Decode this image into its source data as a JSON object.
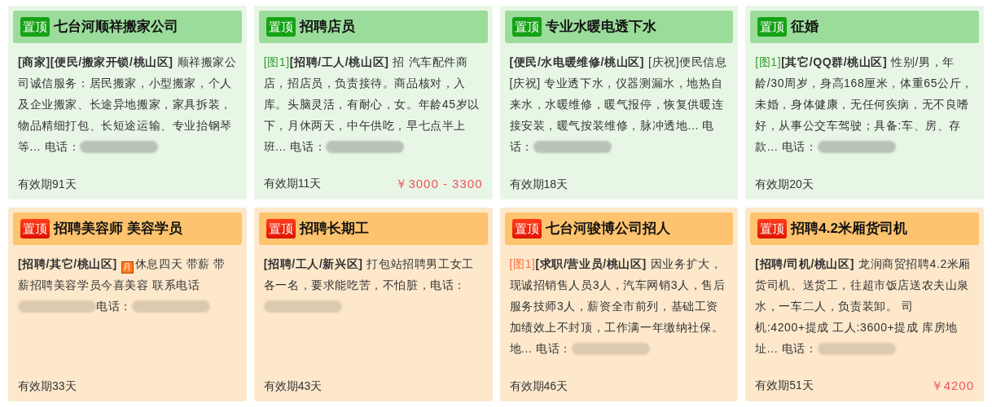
{
  "posts": [
    {
      "kind": "green",
      "badge": "置顶",
      "title": "七台河顺祥搬家公司",
      "body": [
        {
          "kind": "category",
          "text": "[商家][便民/搬家开锁/桃山区]"
        },
        {
          "kind": "text",
          "text": "顺祥搬家公司诚信服务：居民搬家，小型搬家，个人及企业搬家、长途异地搬家，家具拆装，物品精细打包、长短途运输、专业抬钢琴等... 电话："
        },
        {
          "kind": "redacted"
        }
      ],
      "validity": "有效期91天"
    },
    {
      "kind": "green",
      "badge": "置顶",
      "title": "招聘店员",
      "body": [
        {
          "kind": "tag",
          "text": "[图1]"
        },
        {
          "kind": "category",
          "text": "[招聘/工人/桃山区]"
        },
        {
          "kind": "text",
          "text": "招 汽车配件商店，招店员，负责接待。商品核对，入库。头脑灵活，有耐心，女。年龄45岁以下，月休两天，中午供吃，早七点半上班... 电话："
        },
        {
          "kind": "redacted"
        }
      ],
      "validity": "有效期11天",
      "price": "￥3000 - 3300"
    },
    {
      "kind": "green",
      "badge": "置顶",
      "title": "专业水暖电透下水",
      "body": [
        {
          "kind": "category",
          "text": "[便民/水电暖维修/桃山区]"
        },
        {
          "kind": "text",
          "text": "[庆祝]便民信息[庆祝] 专业透下水，仪器测漏水，地热自来水，水暖维修，暖气报停，恢复供暖连接安装，暖气按装维修，脉冲透地... 电话："
        },
        {
          "kind": "redacted"
        }
      ],
      "validity": "有效期18天"
    },
    {
      "kind": "green",
      "badge": "置顶",
      "title": "征婚",
      "body": [
        {
          "kind": "tag",
          "text": "[图1]"
        },
        {
          "kind": "category",
          "text": "[其它/QQ群/桃山区]"
        },
        {
          "kind": "text",
          "text": "性别/男，年龄/30周岁，身高168厘米，体重65公斤，未婚，身体健康，无任何疾病，无不良嗜好，从事公交车驾驶；具备:车、房、存款... 电话："
        },
        {
          "kind": "redacted"
        }
      ],
      "validity": "有效期20天"
    },
    {
      "kind": "orange",
      "badge": "置顶",
      "title": "招聘美容师 美容学员",
      "body": [
        {
          "kind": "category",
          "text": "[招聘/其它/桃山区]"
        },
        {
          "kind": "month",
          "text": "月"
        },
        {
          "kind": "text",
          "text": "休息四天 带薪 带薪招聘美容学员今喜美容 联系电话"
        },
        {
          "kind": "redacted"
        },
        {
          "kind": "text",
          "text": "电话："
        },
        {
          "kind": "redacted"
        }
      ],
      "validity": "有效期33天"
    },
    {
      "kind": "orange",
      "badge": "置顶",
      "title": "招聘长期工",
      "body": [
        {
          "kind": "category",
          "text": "[招聘/工人/新兴区]"
        },
        {
          "kind": "text",
          "text": "打包站招聘男工女工各一名，要求能吃苦，不怕脏，电话："
        },
        {
          "kind": "redacted"
        }
      ],
      "validity": "有效期43天"
    },
    {
      "kind": "orange",
      "badge": "置顶",
      "title": "七台河骏博公司招人",
      "body": [
        {
          "kind": "tag",
          "text": "[图1]"
        },
        {
          "kind": "category",
          "text": "[求职/营业员/桃山区]"
        },
        {
          "kind": "text",
          "text": "因业务扩大，现诚招销售人员3人，汽车网销3人，售后服务技师3人，薪资全市前列，基础工资加绩效上不封顶，工作满一年缴纳社保。地... 电话："
        },
        {
          "kind": "redacted"
        }
      ],
      "validity": "有效期46天"
    },
    {
      "kind": "orange",
      "badge": "置顶",
      "title": "招聘4.2米厢货司机",
      "body": [
        {
          "kind": "category",
          "text": "[招聘/司机/桃山区]"
        },
        {
          "kind": "text",
          "text": "龙润商贸招聘4.2米厢货司机、送货工，往超市饭店送农夫山泉水，一车二人，负责装卸。 司机:4200+提成 工人:3600+提成 库房地址... 电话："
        },
        {
          "kind": "redacted"
        }
      ],
      "validity": "有效期51天",
      "price": "￥4200"
    }
  ]
}
